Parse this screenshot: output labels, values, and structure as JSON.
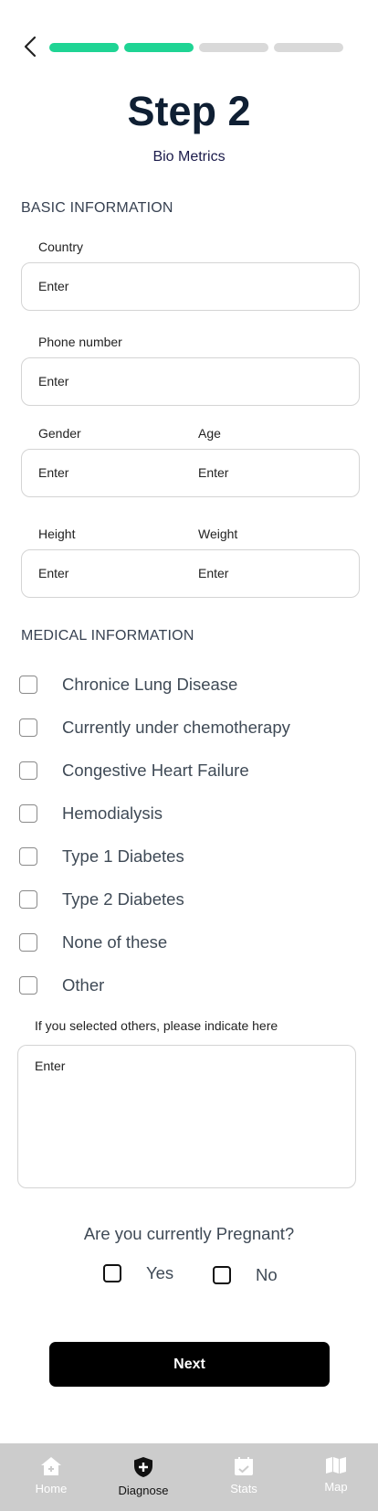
{
  "header": {
    "back_icon": "chevron-left-icon",
    "progress": {
      "total_steps": 4,
      "completed_steps": 2
    },
    "title": "Step 2",
    "subtitle": "Bio Metrics"
  },
  "basic_information": {
    "section_title": "BASIC INFORMATION",
    "country": {
      "label": "Country",
      "placeholder": "Enter"
    },
    "phone": {
      "label": "Phone number",
      "placeholder": "Enter"
    },
    "gender": {
      "label": "Gender",
      "placeholder": "Enter"
    },
    "age": {
      "label": "Age",
      "placeholder": "Enter"
    },
    "height": {
      "label": "Height",
      "placeholder": "Enter"
    },
    "weight": {
      "label": "Weight",
      "placeholder": "Enter"
    }
  },
  "medical_information": {
    "section_title": "MEDICAL INFORMATION",
    "conditions": [
      "Chronice Lung Disease",
      "Currently under chemotherapy",
      "Congestive Heart Failure",
      "Hemodialysis",
      "Type 1 Diabetes",
      "Type 2 Diabetes",
      "None of these",
      "Other"
    ],
    "other_note": "If you selected others, please indicate here",
    "other_placeholder": "Enter"
  },
  "pregnancy": {
    "question": "Are you currently Pregnant?",
    "yes_label": "Yes",
    "no_label": "No"
  },
  "next_button": "Next",
  "bottom_nav": {
    "items": [
      {
        "label": "Home",
        "icon": "home-icon",
        "active": false
      },
      {
        "label": "Diagnose",
        "icon": "shield-plus-icon",
        "active": true
      },
      {
        "label": "Stats",
        "icon": "calendar-check-icon",
        "active": false
      },
      {
        "label": "Map",
        "icon": "map-icon",
        "active": false
      }
    ]
  },
  "colors": {
    "progress_done": "#1fd494",
    "progress_pending": "#d9d9d9",
    "title": "#0f1f33",
    "nav_bar": "#cccccc",
    "button": "#000000"
  }
}
